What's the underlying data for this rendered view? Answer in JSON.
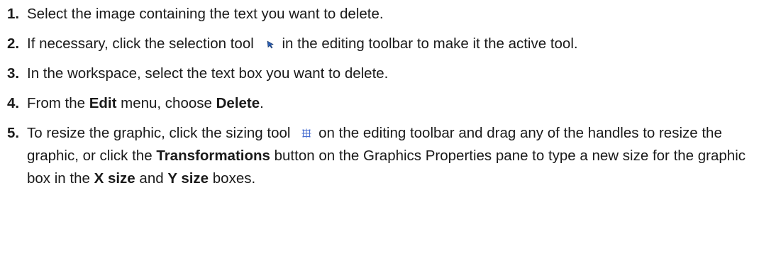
{
  "steps": [
    {
      "num": "1.",
      "text": "Select the image containing the text you want to delete."
    },
    {
      "num": "2.",
      "before": "If necessary, click the selection tool",
      "after": "in the editing toolbar to make it the active tool.",
      "icon": "selection-tool-icon"
    },
    {
      "num": "3.",
      "text": "In the workspace, select the text box you want to delete."
    },
    {
      "num": "4.",
      "p1": "From the ",
      "b1": "Edit",
      "p2": " menu, choose ",
      "b2": "Delete",
      "p3": "."
    },
    {
      "num": "5.",
      "p1": "To resize the graphic, click the sizing tool",
      "icon": "sizing-tool-icon",
      "p2": "on the editing toolbar and drag any of the handles to resize the graphic, or click the ",
      "b1": "Transformations",
      "p3": " button on the Graphics Properties pane to type a new size for the graphic box in the ",
      "b2": "X size",
      "p4": " and ",
      "b3": "Y size",
      "p5": " boxes."
    }
  ],
  "colors": {
    "text": "#1a1a1a",
    "selection_icon": "#2a5db0",
    "sizing_icon": "#4a6fd1"
  }
}
